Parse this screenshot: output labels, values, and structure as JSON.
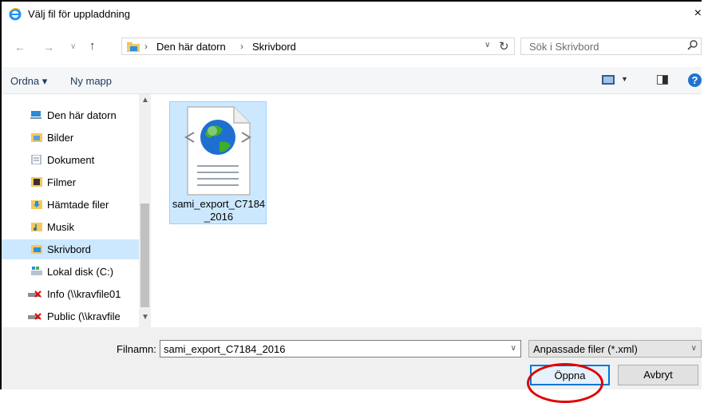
{
  "window": {
    "title": "Välj fil för uppladdning",
    "close_glyph": "×"
  },
  "address": {
    "crumbs": [
      "Den här datorn",
      "Skrivbord"
    ],
    "search_placeholder": "Sök i Skrivbord"
  },
  "toolbar": {
    "organize_label": "Ordna ▾",
    "new_folder_label": "Ny mapp",
    "help_glyph": "?"
  },
  "nav": {
    "items": [
      {
        "label": "Den här datorn",
        "icon": "computer-icon"
      },
      {
        "label": "Bilder",
        "icon": "pictures-folder-icon"
      },
      {
        "label": "Dokument",
        "icon": "documents-folder-icon"
      },
      {
        "label": "Filmer",
        "icon": "videos-folder-icon"
      },
      {
        "label": "Hämtade filer",
        "icon": "downloads-folder-icon"
      },
      {
        "label": "Musik",
        "icon": "music-folder-icon"
      },
      {
        "label": "Skrivbord",
        "icon": "desktop-folder-icon",
        "selected": true
      },
      {
        "label": "Lokal disk (C:)",
        "icon": "local-disk-icon"
      },
      {
        "label": "Info (\\\\kravfile01",
        "icon": "disconnected-drive-icon"
      },
      {
        "label": "Public (\\\\kravfile",
        "icon": "disconnected-drive-icon"
      }
    ]
  },
  "files": [
    {
      "name": "sami_export_C7184_2016",
      "icon": "xml-file-icon",
      "selected": true
    }
  ],
  "bottom": {
    "filename_label": "Filnamn:",
    "filename_value": "sami_export_C7184_2016",
    "filter_value": "Anpassade filer (*.xml)",
    "open_label": "Öppna",
    "cancel_label": "Avbryt"
  },
  "colors": {
    "selection": "#cce8ff",
    "accent": "#0078d7",
    "annotation_circle": "#e00000"
  }
}
